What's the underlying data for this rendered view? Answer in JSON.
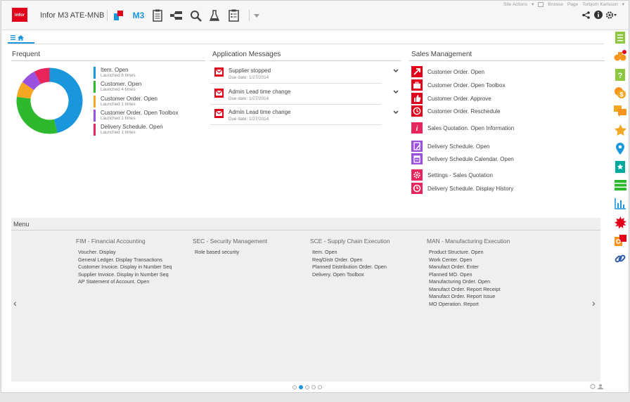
{
  "header": {
    "logo_text": "infor",
    "app_title": "Infor M3 ATE-MNB",
    "m3_label": "M3",
    "site_actions": "Site Actions",
    "browse": "Browse",
    "page": "Page",
    "user": "Torbjorn Karlsson",
    "brand_red": "#e2001a",
    "accent_blue": "#1a96dc"
  },
  "frequent": {
    "title": "Frequent",
    "items": [
      {
        "name": "Item. Open",
        "sub": "Launched 6 times",
        "color": "#1a96dc",
        "count": 6
      },
      {
        "name": "Customer. Open",
        "sub": "Launched 4 times",
        "color": "#2eb82e",
        "count": 4
      },
      {
        "name": "Customer Order. Open",
        "sub": "Launched 1 times",
        "color": "#f5a623",
        "count": 1
      },
      {
        "name": "Customer Order. Open Toolbox",
        "sub": "Launched 1 times",
        "color": "#9b51e0",
        "count": 1
      },
      {
        "name": "Delivery Schedule. Open",
        "sub": "Launched 1 times",
        "color": "#e8245c",
        "count": 1
      }
    ]
  },
  "messages": {
    "title": "Application Messages",
    "items": [
      {
        "title": "Supplier stopped",
        "due": "Due date: 1/27/2014"
      },
      {
        "title": "Admin Lead time change",
        "due": "Due date: 1/27/2014"
      },
      {
        "title": "Admin Lead time change",
        "due": "Due date: 1/27/2014"
      }
    ]
  },
  "sales": {
    "title": "Sales Management",
    "items": [
      {
        "label": "Customer Order. Open",
        "color": "#e2001a",
        "icon": "arrow-icon"
      },
      {
        "label": "Customer Order. Open Toolbox",
        "color": "#e2001a",
        "icon": "toolbox-icon"
      },
      {
        "label": "Customer Order. Approve",
        "color": "#e2001a",
        "icon": "thumb-icon"
      },
      {
        "label": "Customer Order. Reschedule",
        "color": "#e2001a",
        "icon": "clock-icon"
      },
      {
        "label": "Sales Quotation. Open Information",
        "color": "#e8245c",
        "icon": "info-icon"
      },
      {
        "label": "Delivery Schedule. Open",
        "color": "#9b51e0",
        "icon": "pencil-icon"
      },
      {
        "label": "Delivery Schedule Calendar. Open",
        "color": "#9b51e0",
        "icon": "calendar-icon"
      },
      {
        "label": "Settings - Sales Quotation",
        "color": "#e8245c",
        "icon": "gear-icon"
      },
      {
        "label": "Delivery Schedule. Display History",
        "color": "#e8245c",
        "icon": "history-icon"
      }
    ]
  },
  "menu": {
    "title": "Menu",
    "columns": [
      {
        "heading": "FIM - Financial Accounting",
        "items": [
          "Voucher. Display",
          "General Ledger. Display Transactions",
          "Customer Invoice. Display in Number Seq",
          "Supplier Invoice. Display in Number Seq",
          "AP Statement of Account. Open"
        ]
      },
      {
        "heading": "SEC - Security Management",
        "items": [
          "Role based security"
        ]
      },
      {
        "heading": "SCE - Supply Chain Execution",
        "items": [
          "Item. Open",
          "Req/Distr Order. Open",
          "Planned Distribution Order. Open",
          "Delivery. Open Toolbox"
        ]
      },
      {
        "heading": "MAN - Manufacturing Execution",
        "items": [
          "Product Structure. Open",
          "Work Center. Open",
          "Manufact Order. Enter",
          "Planned MO. Open",
          "Manufacturing Order. Open",
          "Manufact Order. Report Receipt",
          "Manufact Order. Report Issue",
          "MO Operation. Report"
        ]
      }
    ]
  },
  "pager": {
    "pages": 5,
    "current": 2
  }
}
